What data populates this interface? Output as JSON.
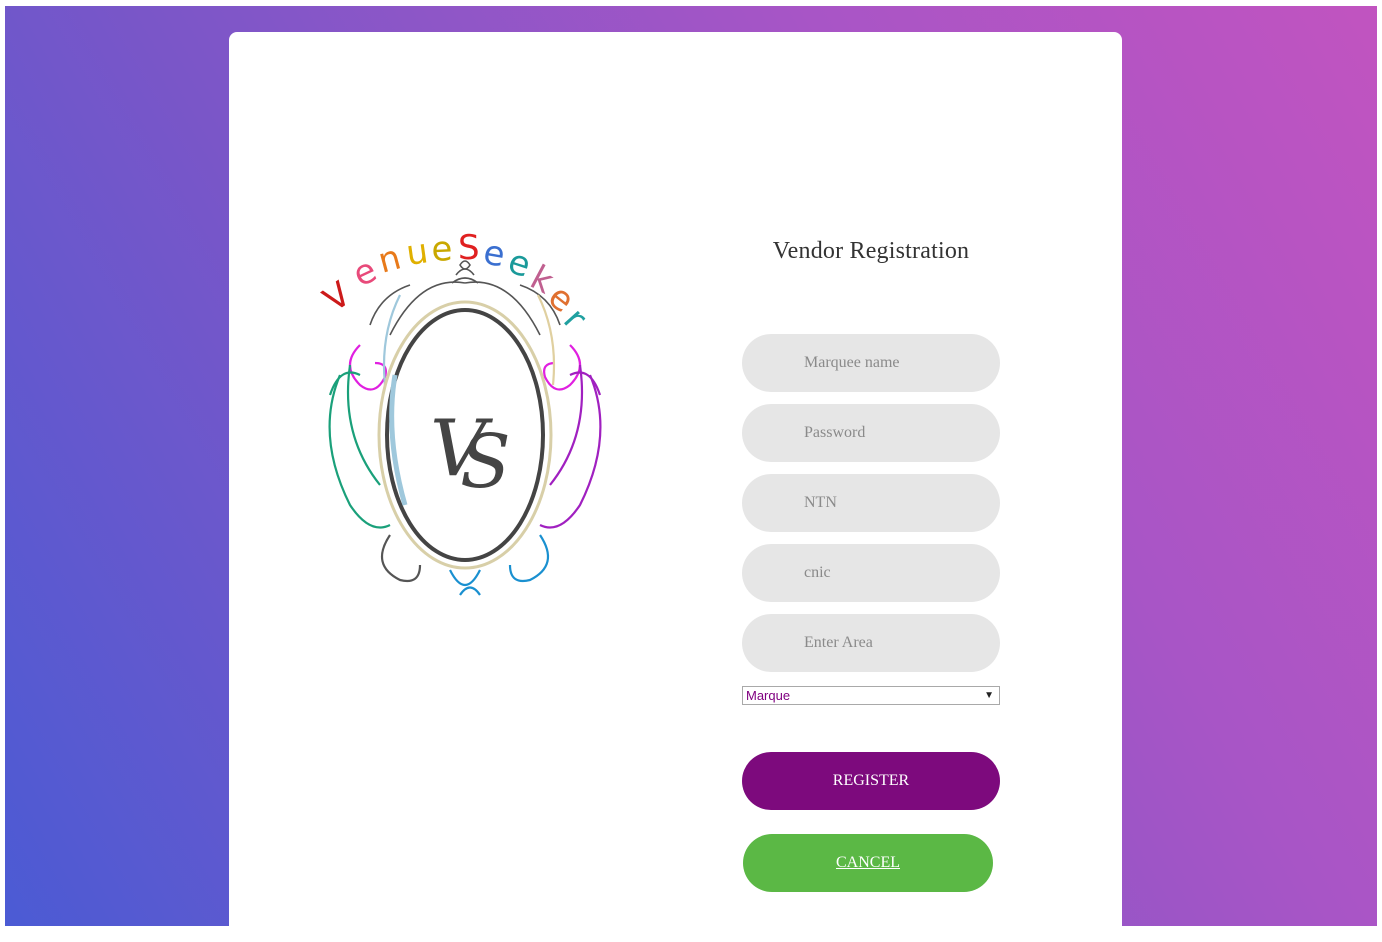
{
  "logo": {
    "brand_text": "Venue Seeker",
    "monogram": "VS"
  },
  "form": {
    "title": "Vendor Registration",
    "fields": {
      "marquee_name_placeholder": "Marquee name",
      "password_placeholder": "Password",
      "ntn_placeholder": "NTN",
      "cnic_placeholder": "cnic",
      "area_placeholder": "Enter Area"
    },
    "type_select": {
      "selected": "Marque",
      "arrow": "▼"
    },
    "register_label": "REGISTER",
    "cancel_label": "CANCEL"
  },
  "colors": {
    "register": "#7d0a7d",
    "cancel": "#5bb845",
    "select_text": "#800080"
  }
}
